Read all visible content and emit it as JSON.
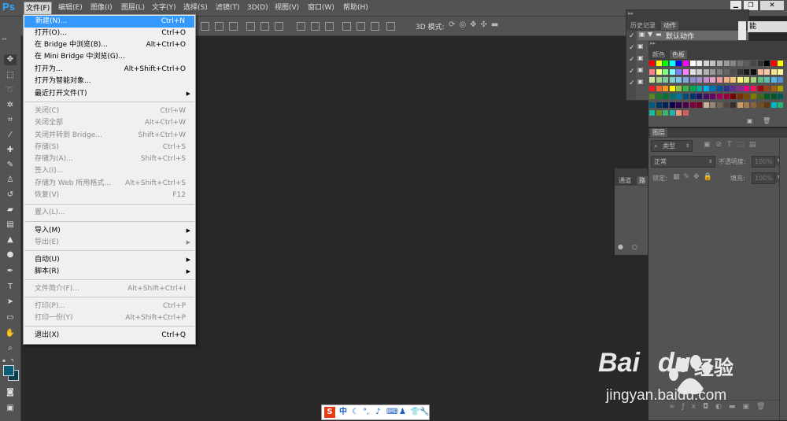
{
  "app": {
    "logo": "Ps"
  },
  "menubar": [
    {
      "label": "文件(F)",
      "active": true
    },
    {
      "label": "编辑(E)"
    },
    {
      "label": "图像(I)"
    },
    {
      "label": "图层(L)"
    },
    {
      "label": "文字(Y)"
    },
    {
      "label": "选择(S)"
    },
    {
      "label": "滤镜(T)"
    },
    {
      "label": "3D(D)"
    },
    {
      "label": "视图(V)"
    },
    {
      "label": "窗口(W)"
    },
    {
      "label": "帮助(H)"
    }
  ],
  "optionsbar": {
    "mode3d": "3D 模式:"
  },
  "file_menu": {
    "items": [
      {
        "label": "新建(N)...",
        "shortcut": "Ctrl+N",
        "highlighted": true
      },
      {
        "label": "打开(O)...",
        "shortcut": "Ctrl+O"
      },
      {
        "label": "在 Bridge 中浏览(B)...",
        "shortcut": "Alt+Ctrl+O"
      },
      {
        "label": "在 Mini Bridge 中浏览(G)...",
        "shortcut": ""
      },
      {
        "label": "打开为...",
        "shortcut": "Alt+Shift+Ctrl+O"
      },
      {
        "label": "打开为智能对象...",
        "shortcut": ""
      },
      {
        "label": "最近打开文件(T)",
        "shortcut": "",
        "submenu": true
      },
      {
        "label": "关闭(C)",
        "shortcut": "Ctrl+W",
        "disabled": true
      },
      {
        "label": "关闭全部",
        "shortcut": "Alt+Ctrl+W",
        "disabled": true
      },
      {
        "label": "关闭并转到 Bridge...",
        "shortcut": "Shift+Ctrl+W",
        "disabled": true
      },
      {
        "label": "存储(S)",
        "shortcut": "Ctrl+S",
        "disabled": true
      },
      {
        "label": "存储为(A)...",
        "shortcut": "Shift+Ctrl+S",
        "disabled": true
      },
      {
        "label": "签入(I)...",
        "shortcut": "",
        "disabled": true
      },
      {
        "label": "存储为 Web 所用格式...",
        "shortcut": "Alt+Shift+Ctrl+S",
        "disabled": true
      },
      {
        "label": "恢复(V)",
        "shortcut": "F12",
        "disabled": true
      },
      {
        "label": "置入(L)...",
        "shortcut": "",
        "disabled": true
      },
      {
        "label": "导入(M)",
        "shortcut": "",
        "submenu": true
      },
      {
        "label": "导出(E)",
        "shortcut": "",
        "submenu": true,
        "disabled": true
      },
      {
        "label": "自动(U)",
        "shortcut": "",
        "submenu": true
      },
      {
        "label": "脚本(R)",
        "shortcut": "",
        "submenu": true
      },
      {
        "label": "文件简介(F)...",
        "shortcut": "Alt+Shift+Ctrl+I",
        "disabled": true
      },
      {
        "label": "打印(P)...",
        "shortcut": "Ctrl+P",
        "disabled": true
      },
      {
        "label": "打印一份(Y)",
        "shortcut": "Alt+Shift+Ctrl+P",
        "disabled": true
      },
      {
        "label": "退出(X)",
        "shortcut": "Ctrl+Q"
      }
    ]
  },
  "history_panel": {
    "tabs": [
      "历史记录",
      "动作"
    ],
    "action_set": "默认动作"
  },
  "workspace_label": "能",
  "swatches_panel": {
    "tabs": [
      "颜色",
      "色板"
    ]
  },
  "paths_panel": {
    "tabs": [
      "通道",
      "路"
    ]
  },
  "layers_panel": {
    "title": "图层",
    "filter": "类型",
    "blend_mode": "正常",
    "opacity_label": "不透明度:",
    "opacity_value": "100%",
    "lock_label": "锁定:",
    "fill_label": "填充:",
    "fill_value": "100%"
  },
  "ime": {
    "label": "中"
  },
  "watermark": {
    "site": "jingyan.baidu.com",
    "logo_text": "Bai",
    "logo_text2": "du",
    "logo_cn": "经验"
  },
  "colors": {
    "accent": "#3399ff",
    "menu_bg": "#f0f0f0",
    "ps_blue": "#31a8ff",
    "panel_bg": "#535353",
    "workspace_bg": "#282828"
  }
}
